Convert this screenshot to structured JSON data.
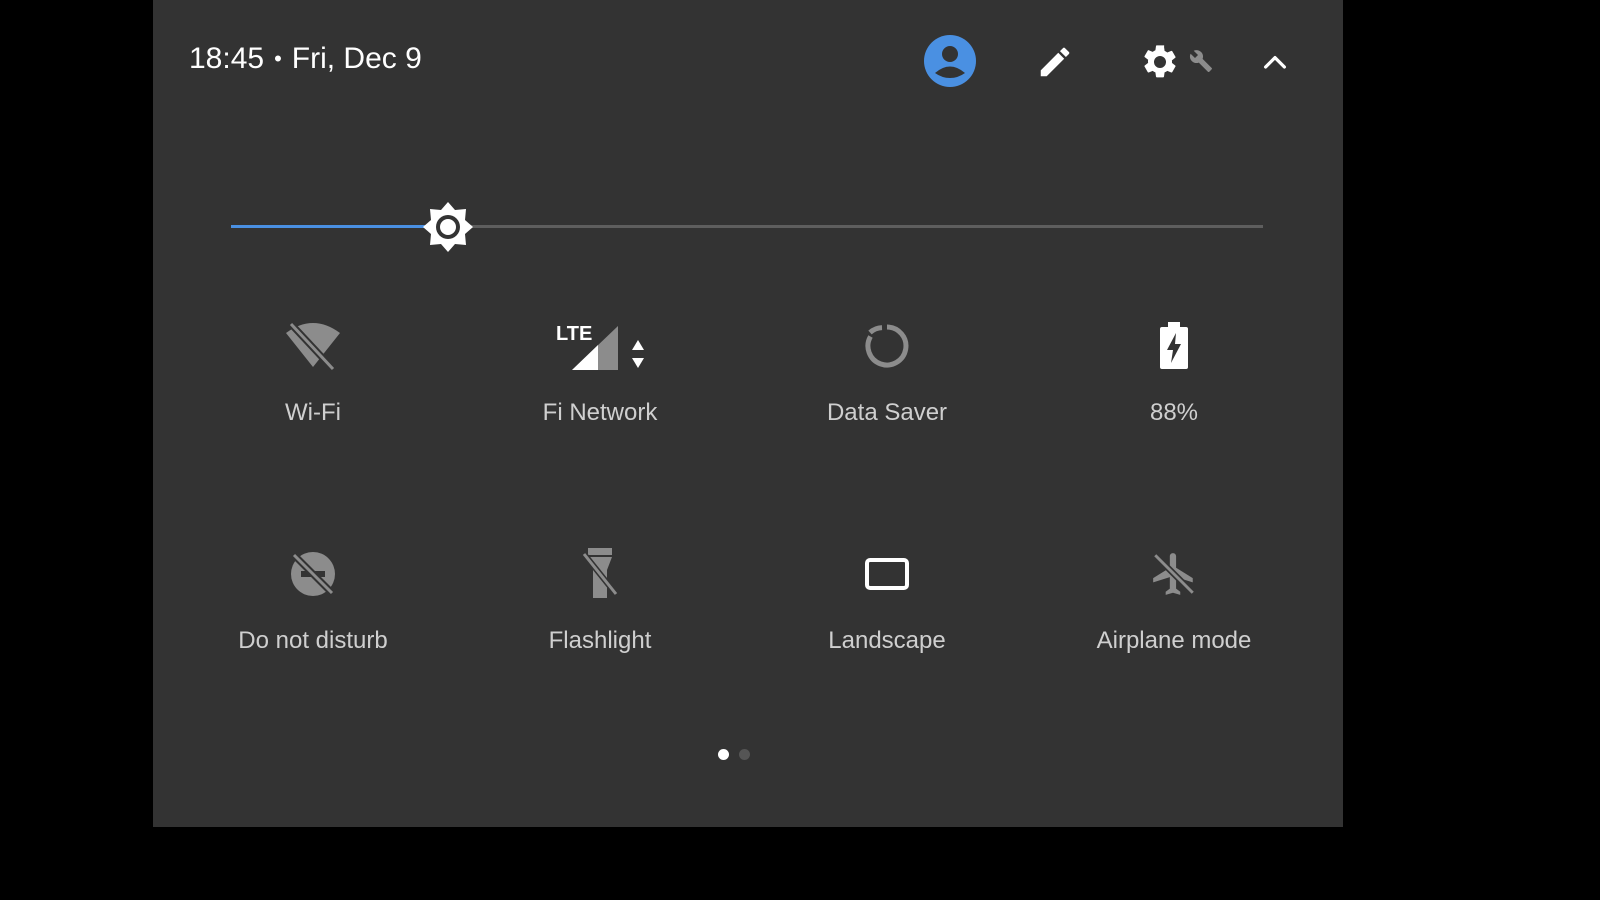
{
  "colors": {
    "panel_bg": "#333333",
    "accent": "#4a90e2",
    "icon_active": "#ffffff",
    "icon_inactive": "#8c8c8c",
    "label": "#cfcfcf"
  },
  "header": {
    "time": "18:45",
    "separator": "•",
    "date": "Fri, Dec 9",
    "icons": [
      "account-circle-icon",
      "edit-pencil-icon",
      "settings-gear-icon",
      "wrench-icon",
      "chevron-up-icon"
    ]
  },
  "brightness": {
    "level": 0.21,
    "icon": "brightness-sun-icon"
  },
  "tiles": [
    {
      "label": "Wi-Fi",
      "icon": "wifi-off-icon",
      "active": false
    },
    {
      "label": "Fi Network",
      "icon": "lte-signal-icon",
      "active": true
    },
    {
      "label": "Data Saver",
      "icon": "data-saver-icon",
      "active": false
    },
    {
      "label": "88%",
      "icon": "battery-charging-icon",
      "active": true
    },
    {
      "label": "Do not disturb",
      "icon": "do-not-disturb-off-icon",
      "active": false
    },
    {
      "label": "Flashlight",
      "icon": "flashlight-off-icon",
      "active": false
    },
    {
      "label": "Landscape",
      "icon": "screen-rotation-landscape-icon",
      "active": true
    },
    {
      "label": "Airplane mode",
      "icon": "airplane-off-icon",
      "active": false
    }
  ],
  "pager": {
    "pages": 2,
    "current": 1
  }
}
